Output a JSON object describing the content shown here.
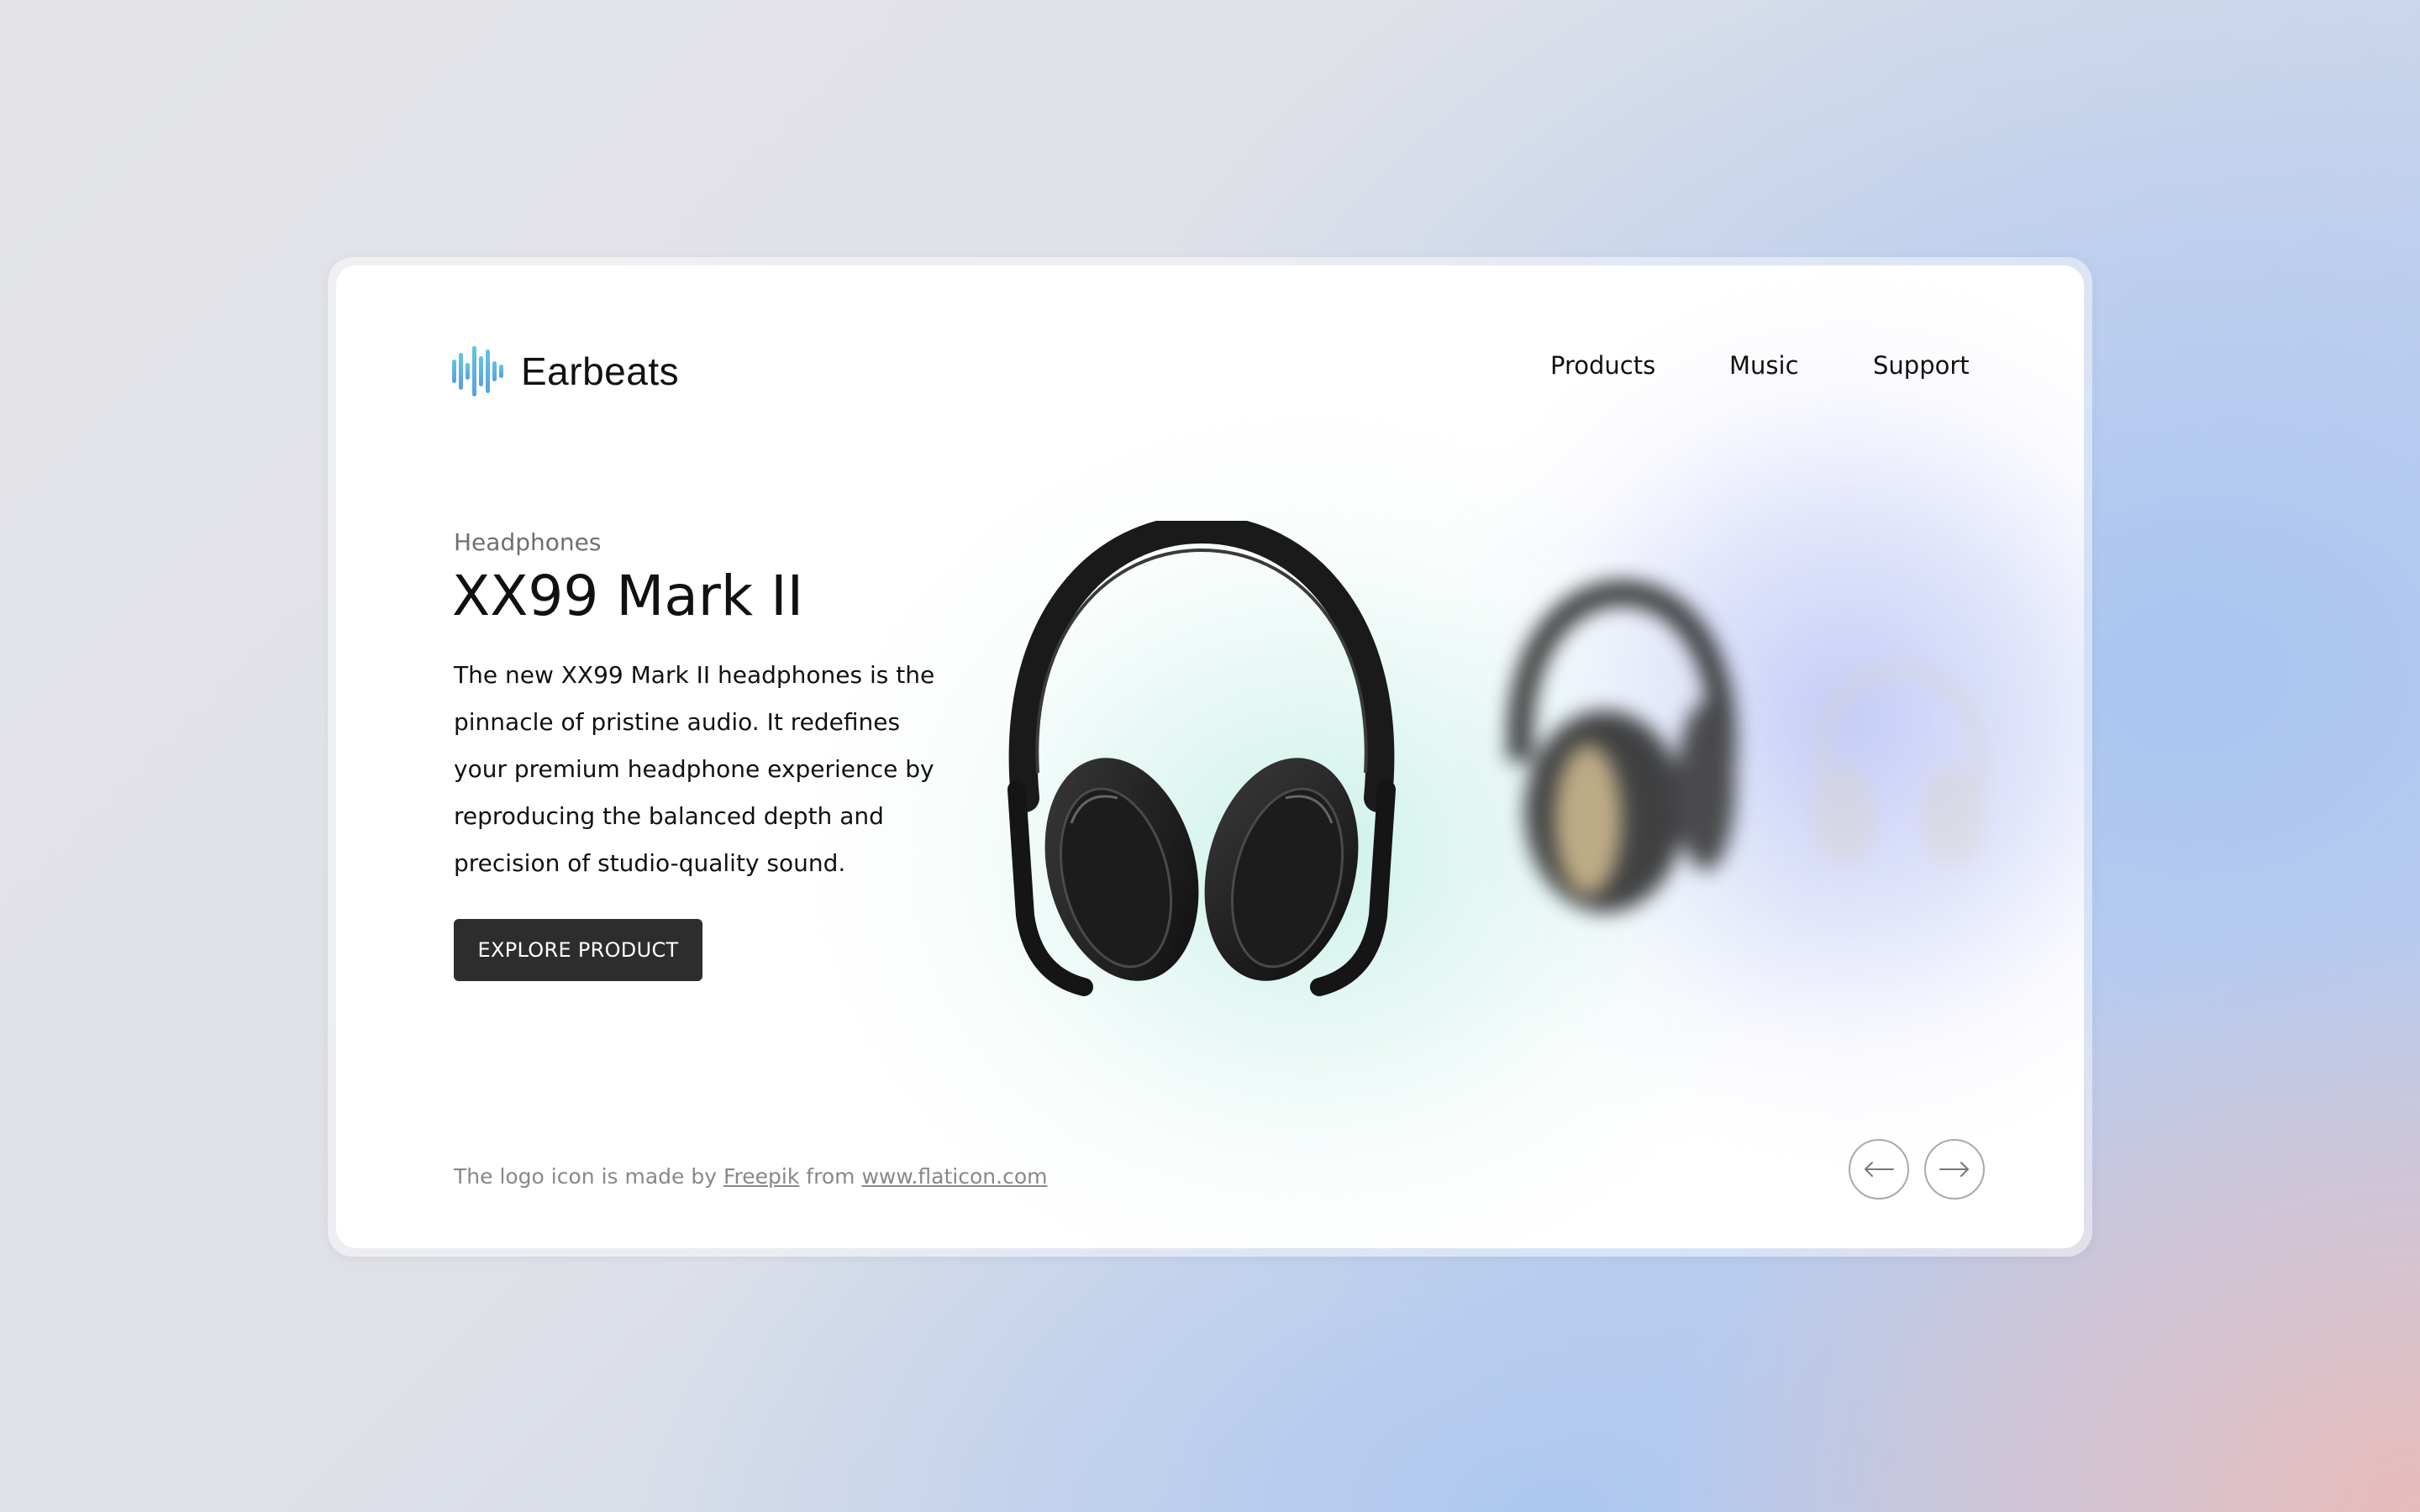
{
  "brand": {
    "name": "Earbeats",
    "logo_icon": "soundwave-icon",
    "logo_colors": [
      "#62c6e0",
      "#5a9fe0"
    ]
  },
  "nav": {
    "items": [
      {
        "label": "Products"
      },
      {
        "label": "Music"
      },
      {
        "label": "Support"
      }
    ]
  },
  "hero": {
    "category": "Headphones",
    "title": "XX99 Mark II",
    "description": "The new XX99 Mark II headphones is the pinnacle of pristine audio. It redefines your premium headphone experience by reproducing the balanced depth and precision of studio-quality sound.",
    "cta_label": "EXPLORE PRODUCT"
  },
  "carousel": {
    "items": [
      {
        "name": "headphones-black",
        "state": "active"
      },
      {
        "name": "headphones-black-gold",
        "state": "blurred"
      },
      {
        "name": "headphones-white",
        "state": "faint"
      }
    ],
    "prev_icon": "arrow-left-icon",
    "next_icon": "arrow-right-icon"
  },
  "footer": {
    "credit_prefix": "The logo icon is made by",
    "credit_author": "Freepik",
    "credit_middle": "from",
    "credit_site": "www.flaticon.com"
  },
  "colors": {
    "cta_background": "#2d2d2d",
    "text": "#111111",
    "muted": "#888888"
  }
}
